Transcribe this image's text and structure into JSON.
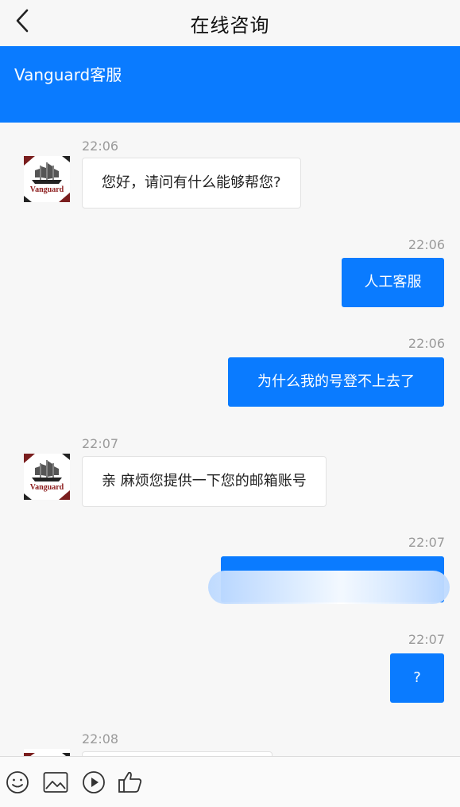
{
  "nav": {
    "title": "在线咨询"
  },
  "banner": {
    "title": "Vanguard客服"
  },
  "avatar": {
    "brand": "Vanguard"
  },
  "messages": [
    {
      "time": "22:06",
      "side": "in",
      "text": "您好，请问有什么能够帮您?"
    },
    {
      "time": "22:06",
      "side": "out",
      "text": "人工客服"
    },
    {
      "time": "22:06",
      "side": "out",
      "text": "为什么我的号登不上去了"
    },
    {
      "time": "22:07",
      "side": "in",
      "text": "亲 麻烦您提供一下您的邮箱账号"
    },
    {
      "time": "22:07",
      "side": "out",
      "text": ""
    },
    {
      "time": "22:07",
      "side": "out",
      "text": "?"
    },
    {
      "time": "22:08",
      "side": "in",
      "text": ""
    }
  ],
  "colors": {
    "accent": "#0a7bff",
    "bubble_in": "#ffffff",
    "time": "#9a9a9a"
  },
  "toolbar": {
    "icons": [
      "smile-icon",
      "image-icon",
      "play-icon",
      "thumbs-up-icon"
    ]
  }
}
